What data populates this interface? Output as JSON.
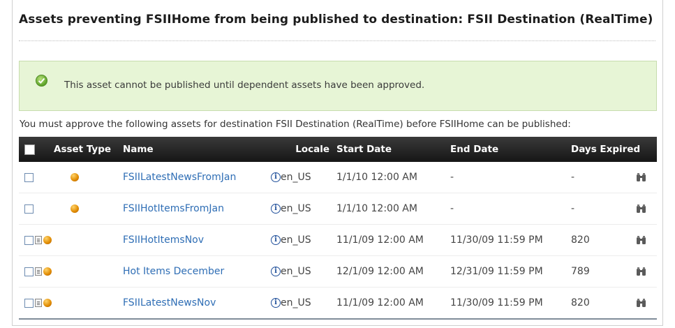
{
  "panel": {
    "title": "Assets preventing FSIIHome from being published to destination: FSII Destination (RealTime)"
  },
  "notice": {
    "icon": "checkmark-icon",
    "message": "This asset cannot be published until dependent assets have been approved."
  },
  "instructions": "You must approve the following assets for destination FSII Destination (RealTime) before FSIIHome can be published:",
  "table": {
    "columns": {
      "asset_type": "Asset Type",
      "name": "Name",
      "locale": "Locale",
      "start_date": "Start Date",
      "end_date": "End Date",
      "days_expired": "Days Expired"
    },
    "rows": [
      {
        "has_doc_icon": false,
        "name": "FSIILatestNewsFromJan",
        "locale": "en_US",
        "start_date": "1/1/10 12:00 AM",
        "end_date": "-",
        "days_expired": "-"
      },
      {
        "has_doc_icon": false,
        "name": "FSIIHotItemsFromJan",
        "locale": "en_US",
        "start_date": "1/1/10 12:00 AM",
        "end_date": "-",
        "days_expired": "-"
      },
      {
        "has_doc_icon": true,
        "name": "FSIIHotItemsNov",
        "locale": "en_US",
        "start_date": "11/1/09 12:00 AM",
        "end_date": "11/30/09 11:59 PM",
        "days_expired": "820"
      },
      {
        "has_doc_icon": true,
        "name": "Hot Items December",
        "locale": "en_US",
        "start_date": "12/1/09 12:00 AM",
        "end_date": "12/31/09 11:59 PM",
        "days_expired": "789"
      },
      {
        "has_doc_icon": true,
        "name": "FSIILatestNewsNov",
        "locale": "en_US",
        "start_date": "11/1/09 12:00 AM",
        "end_date": "11/30/09 11:59 PM",
        "days_expired": "820"
      }
    ]
  },
  "colors": {
    "header_bg": "#1e1e1e",
    "link": "#2f6eb5",
    "notice_bg": "#e7f5d6",
    "asset_icon": "#e08a00"
  }
}
